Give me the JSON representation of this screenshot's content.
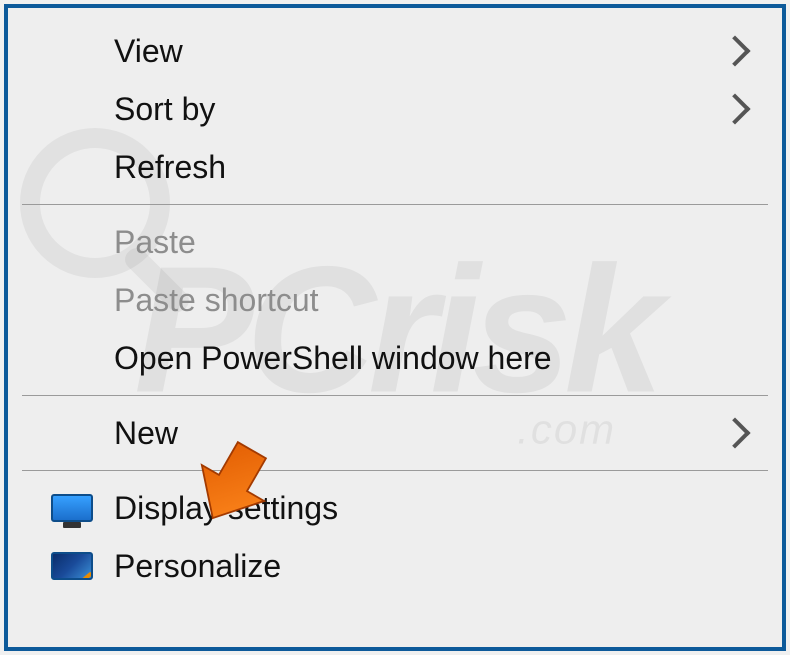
{
  "menu": {
    "view": "View",
    "sortby": "Sort by",
    "refresh": "Refresh",
    "paste": "Paste",
    "paste_shortcut": "Paste shortcut",
    "open_powershell": "Open PowerShell window here",
    "new": "New",
    "display_settings": "Display settings",
    "personalize": "Personalize"
  },
  "watermark": {
    "main": "PCrisk",
    "sub": ".com"
  }
}
